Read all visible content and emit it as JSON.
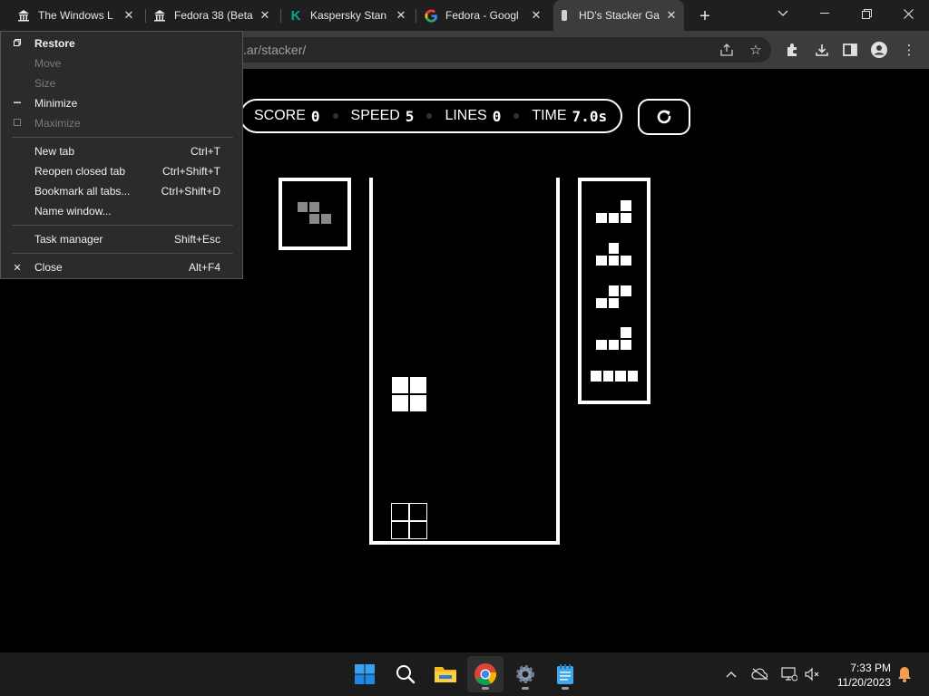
{
  "tabs": [
    {
      "title": "The Windows L",
      "icon": "bank-icon"
    },
    {
      "title": "Fedora 38 (Beta",
      "icon": "bank-icon"
    },
    {
      "title": "Kaspersky Stan",
      "icon": "kaspersky-icon"
    },
    {
      "title": "Fedora - Googl",
      "icon": "google-icon"
    },
    {
      "title": "HD's Stacker Ga",
      "icon": "page-icon",
      "active": true
    }
  ],
  "toolbar": {
    "url_visible": ".ar/stacker/"
  },
  "system_menu": {
    "items": [
      {
        "icon": "restore-icon",
        "label": "Restore",
        "shortcut": "",
        "enabled": true,
        "bold": true
      },
      {
        "icon": "",
        "label": "Move",
        "shortcut": "",
        "enabled": false
      },
      {
        "icon": "",
        "label": "Size",
        "shortcut": "",
        "enabled": false
      },
      {
        "icon": "minimize-icon",
        "label": "Minimize",
        "shortcut": "",
        "enabled": true
      },
      {
        "icon": "maximize-icon",
        "label": "Maximize",
        "shortcut": "",
        "enabled": false
      },
      {
        "icon": "",
        "label": "New tab",
        "shortcut": "Ctrl+T",
        "enabled": true
      },
      {
        "icon": "",
        "label": "Reopen closed tab",
        "shortcut": "Ctrl+Shift+T",
        "enabled": true
      },
      {
        "icon": "",
        "label": "Bookmark all tabs...",
        "shortcut": "Ctrl+Shift+D",
        "enabled": true
      },
      {
        "icon": "",
        "label": "Name window...",
        "shortcut": "",
        "enabled": true
      },
      {
        "icon": "",
        "label": "Task manager",
        "shortcut": "Shift+Esc",
        "enabled": true
      },
      {
        "icon": "close-icon",
        "label": "Close",
        "shortcut": "Alt+F4",
        "enabled": true
      }
    ]
  },
  "game": {
    "score_label": "SCORE",
    "score": "0",
    "speed_label": "SPEED",
    "speed": "5",
    "lines_label": "LINES",
    "lines": "0",
    "time_label": "TIME",
    "time": "7.0s",
    "hold_piece": "Z",
    "next_pieces": [
      "L",
      "T",
      "S",
      "L",
      "I"
    ],
    "active_piece": "O",
    "ghost_piece": "O",
    "colors": {
      "hold": "#888888",
      "block": "#ffffff",
      "background": "#000000"
    }
  },
  "taskbar": {
    "apps": [
      "windows-start-icon",
      "search-icon",
      "file-explorer-icon",
      "chrome-icon",
      "settings-icon",
      "notepad-icon"
    ],
    "time": "7:33 PM",
    "date": "11/20/2023"
  }
}
